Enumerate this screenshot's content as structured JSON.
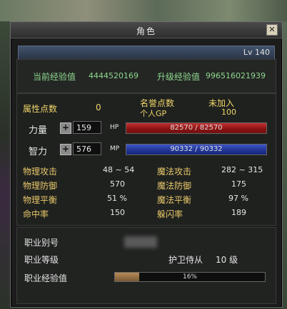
{
  "window": {
    "title": "角色"
  },
  "level": {
    "text": "Lv 140"
  },
  "exp": {
    "current_label": "当前经验值",
    "current_value": "4444520169",
    "next_label": "升级经验值",
    "next_value": "996516021939"
  },
  "points": {
    "attr_label": "属性点数",
    "attr_value": "0",
    "honor_label": "名誉点数",
    "honor_value": "未加入",
    "gp_label": "个人GP",
    "gp_value": "100"
  },
  "stats": {
    "str_label": "力量",
    "str_value": "159",
    "int_label": "智力",
    "int_value": "576"
  },
  "bars": {
    "hp_label": "HP",
    "hp_text": "82570 / 82570",
    "hp_fraction": 1.0,
    "mp_label": "MP",
    "mp_text": "90332 / 90332",
    "mp_fraction": 1.0
  },
  "combat": {
    "phys_atk_label": "物理攻击",
    "phys_atk_value": "48 ~ 54",
    "mag_atk_label": "魔法攻击",
    "mag_atk_value": "282 ~ 315",
    "phys_def_label": "物理防御",
    "phys_def_value": "570",
    "mag_def_label": "魔法防御",
    "mag_def_value": "175",
    "phys_bal_label": "物理平衡",
    "phys_bal_value": "51 %",
    "mag_bal_label": "魔法平衡",
    "mag_bal_value": "97 %",
    "hit_label": "命中率",
    "hit_value": "150",
    "dodge_label": "躲闪率",
    "dodge_value": "189"
  },
  "job": {
    "alias_label": "职业别号",
    "level_label": "职业等级",
    "level_name": "护卫侍从",
    "level_value": "10 级",
    "exp_label": "职业经验值",
    "exp_text": "16%",
    "exp_fraction": 0.16
  },
  "colors": {
    "hp": "#a01818",
    "mp": "#2838a8",
    "accent": "#e8c86a"
  }
}
